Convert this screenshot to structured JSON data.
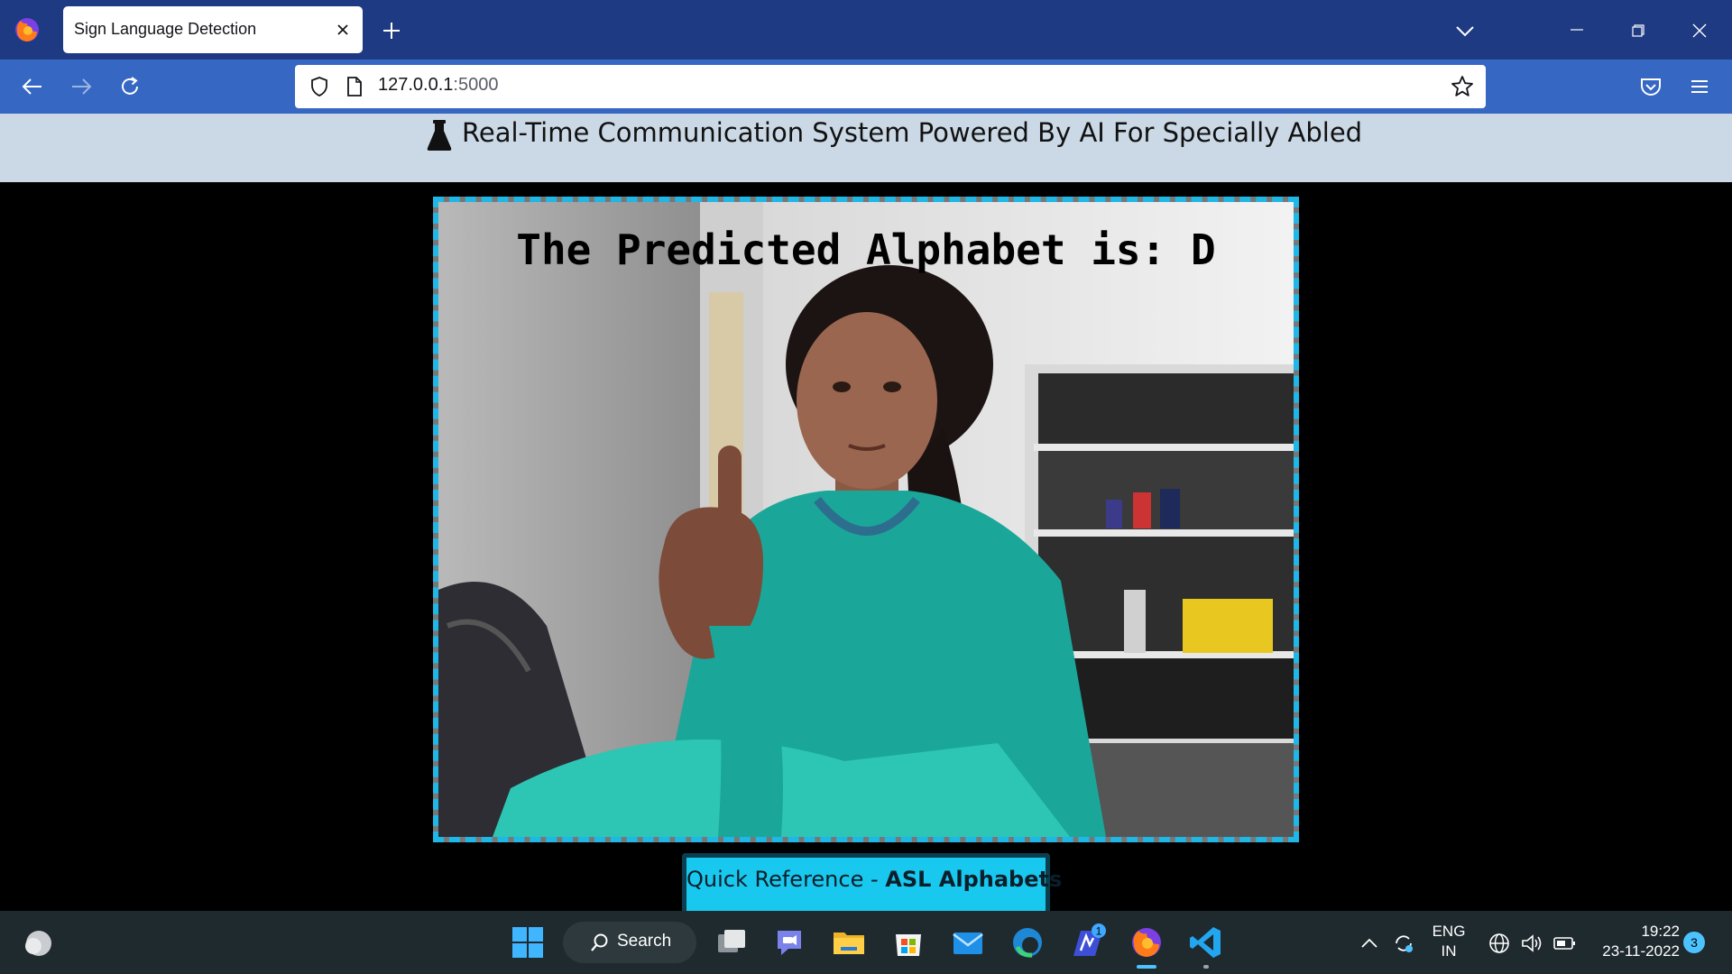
{
  "browser": {
    "tab_title": "Sign Language Detection",
    "url_host": "127.0.0.1",
    "url_port": ":5000"
  },
  "page": {
    "header_title": "Real-Time Communication System Powered By AI For Specially Abled",
    "prediction_text": "The Predicted Alphabet is: D",
    "quick_ref_prefix": "Quick Reference - ",
    "quick_ref_bold": "ASL Alphabets",
    "accent_color": "#1fb7e6",
    "header_bg": "#cbd9e6"
  },
  "taskbar": {
    "search_label": "Search",
    "lang_primary": "ENG",
    "lang_secondary": "IN",
    "time": "19:22",
    "date": "23-11-2022",
    "notification_count": "3",
    "teams_badge": "1"
  }
}
